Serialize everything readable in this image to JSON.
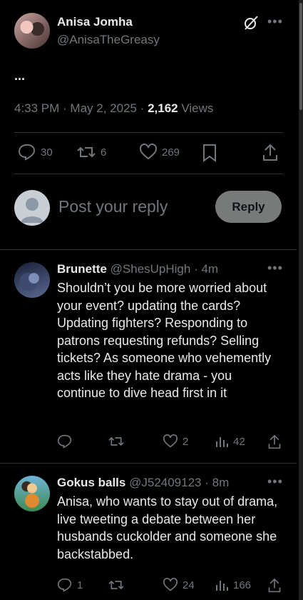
{
  "tweet": {
    "author_name": "Anisa Jomha",
    "author_handle": "@AnisaTheGreasy",
    "text": "...",
    "time": "4:33 PM",
    "date": "May 2, 2025",
    "views_count": "2,162",
    "views_label": "Views",
    "replies": "30",
    "reposts": "6",
    "likes": "269"
  },
  "composer": {
    "placeholder": "Post your reply",
    "button_label": "Reply"
  },
  "replies": [
    {
      "name": "Brunette",
      "handle": "@ShesUpHigh",
      "age": "4m",
      "text": "Shouldn’t you be more worried about your event? updating the cards? Updating fighters? Responding to patrons requesting refunds? Selling tickets? As someone who vehemently acts like they hate drama - you continue to dive head first in it",
      "replies": "",
      "reposts": "",
      "likes": "2",
      "views": "42"
    },
    {
      "name": "Gokus balls",
      "handle": "@J52409123",
      "age": "8m",
      "text": "Anisa, who wants to stay out of drama, live tweeting a debate between her husbands cuckolder and someone she backstabbed.",
      "replies": "1",
      "reposts": "",
      "likes": "24",
      "views": "166"
    }
  ],
  "colors": {
    "background": "#000000",
    "text": "#e7e9ea",
    "secondary": "#71767b",
    "divider": "#2f3336",
    "reply_button": "#787a7a"
  }
}
